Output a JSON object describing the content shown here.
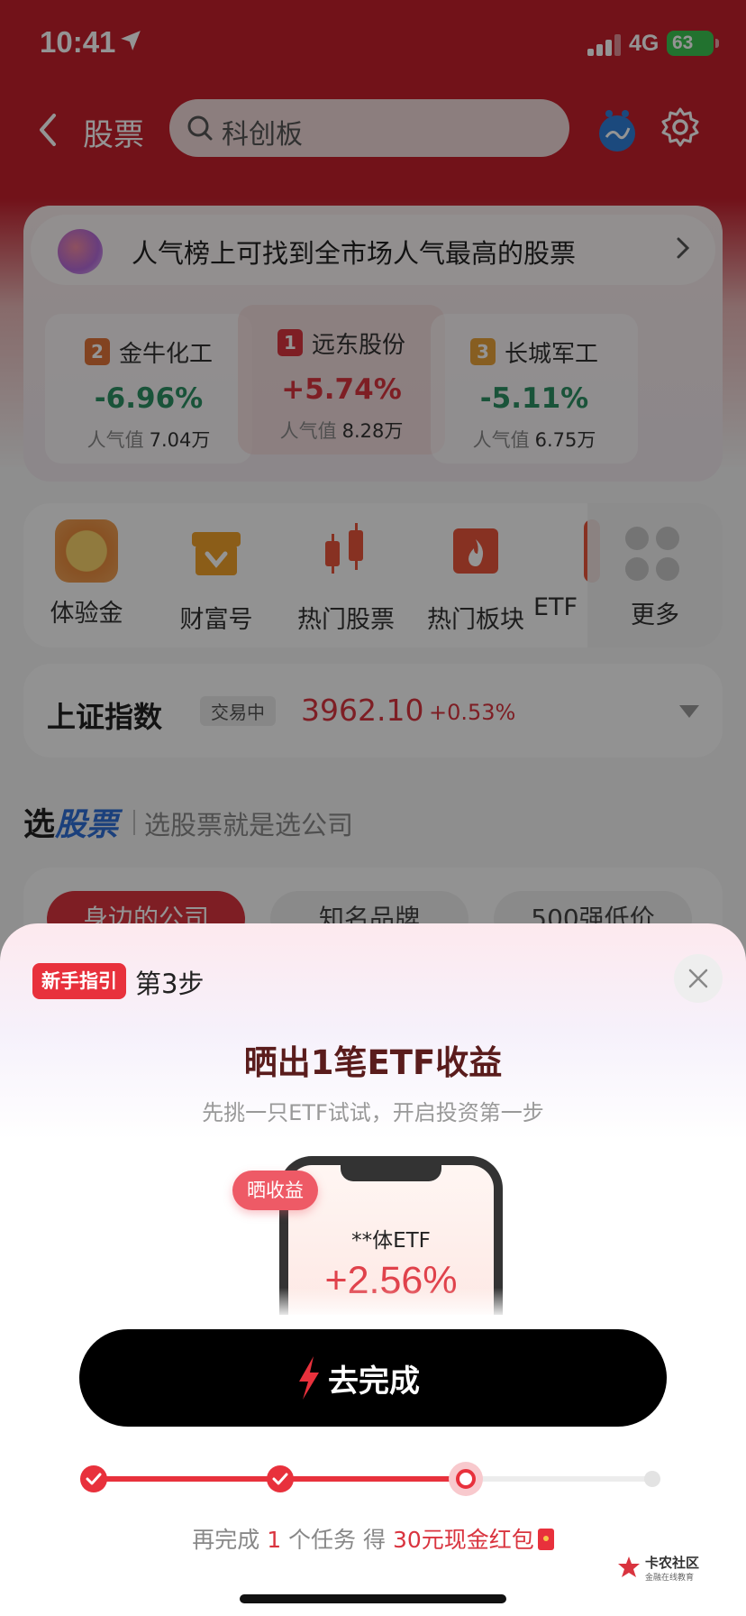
{
  "status_bar": {
    "time": "10:41",
    "network": "4G",
    "battery": "63"
  },
  "nav": {
    "title": "股票",
    "search_text": "科创板"
  },
  "popular": {
    "banner": "人气榜上可找到全市场人气最高的股票",
    "pop_label": "人气值",
    "items": [
      {
        "rank": "2",
        "name": "金牛化工",
        "change": "-6.96%",
        "popularity": "7.04万",
        "direction": "down",
        "badge_color": "#e0743a"
      },
      {
        "rank": "1",
        "name": "远东股份",
        "change": "+5.74%",
        "popularity": "8.28万",
        "direction": "up",
        "badge_color": "#d9343f"
      },
      {
        "rank": "3",
        "name": "长城军工",
        "change": "-5.11%",
        "popularity": "6.75万",
        "direction": "down",
        "badge_color": "#e8a23a"
      }
    ]
  },
  "shortcuts": [
    {
      "label": "体验金",
      "icon": "coin-icon"
    },
    {
      "label": "财富号",
      "icon": "shop-icon"
    },
    {
      "label": "热门股票",
      "icon": "candlestick-icon"
    },
    {
      "label": "热门板块",
      "icon": "fire-block-icon"
    },
    {
      "label": "ETF",
      "icon": "etf-icon"
    }
  ],
  "more_label": "更多",
  "index": {
    "name": "上证指数",
    "status": "交易中",
    "value": "3962.10",
    "change": "+0.53%"
  },
  "pick": {
    "title_prefix": "选",
    "title_highlight": "股票",
    "subtitle": "选股票就是选公司",
    "tabs": [
      "身边的公司",
      "知名品牌",
      "500强低价"
    ]
  },
  "sheet": {
    "tag": "新手指引",
    "step": "第3步",
    "title": "晒出1笔ETF收益",
    "subtitle": "先挑一只ETF试试，开启投资第一步",
    "badge": "晒收益",
    "phone_name": "**体ETF",
    "phone_pct": "+2.56%",
    "button": "去完成",
    "progress_total": 4,
    "progress_current": 3,
    "reward_pre": "再完成",
    "reward_count": "1",
    "reward_mid": "个任务 得",
    "reward_prize": "30元现金红包"
  },
  "watermark": {
    "title": "卡农社区",
    "subtitle": "金融在线教育"
  },
  "colors": {
    "brand_red": "#c41f2c",
    "accent_red": "#e8313c",
    "down_green": "#2b8f63"
  }
}
